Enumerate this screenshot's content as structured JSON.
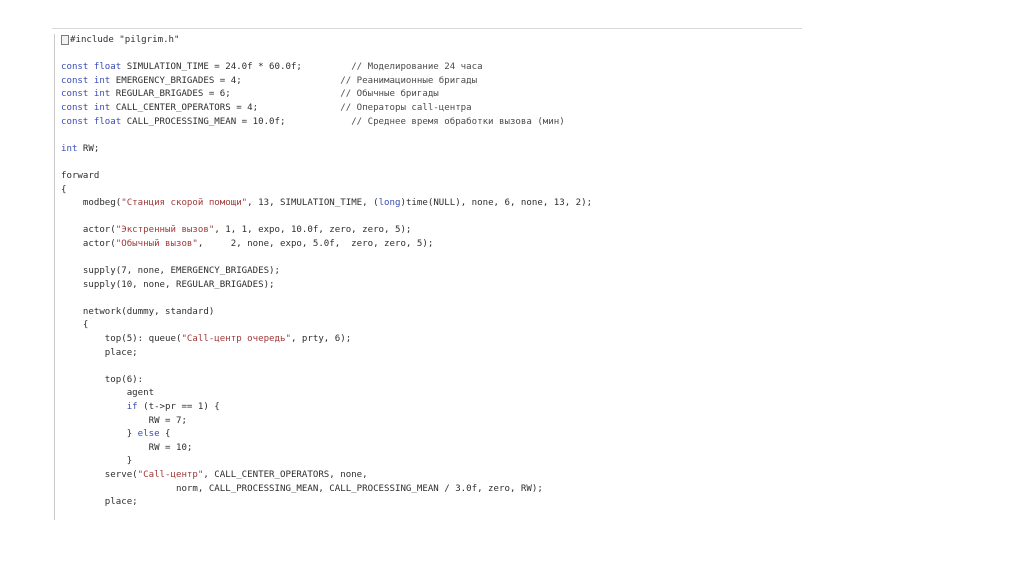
{
  "editor": {
    "lines": [
      [
        {
          "t": "#include \"pilgrim.h\"",
          "c": "txt"
        }
      ],
      [],
      [
        {
          "t": "const float",
          "c": "kw"
        },
        {
          "t": " SIMULATION_TIME = 24.0f * 60.0f;         ",
          "c": "txt"
        },
        {
          "t": "// Моделирование 24 часа",
          "c": "cmt"
        }
      ],
      [
        {
          "t": "const int",
          "c": "kw"
        },
        {
          "t": " EMERGENCY_BRIGADES = 4;                  ",
          "c": "txt"
        },
        {
          "t": "// Реанимационные бригады",
          "c": "cmt"
        }
      ],
      [
        {
          "t": "const int",
          "c": "kw"
        },
        {
          "t": " REGULAR_BRIGADES = 6;                    ",
          "c": "txt"
        },
        {
          "t": "// Обычные бригады",
          "c": "cmt"
        }
      ],
      [
        {
          "t": "const int",
          "c": "kw"
        },
        {
          "t": " CALL_CENTER_OPERATORS = 4;               ",
          "c": "txt"
        },
        {
          "t": "// Операторы call-центра",
          "c": "cmt"
        }
      ],
      [
        {
          "t": "const float",
          "c": "kw"
        },
        {
          "t": " CALL_PROCESSING_MEAN = 10.0f;            ",
          "c": "txt"
        },
        {
          "t": "// Среднее время обработки вызова (мин)",
          "c": "cmt"
        }
      ],
      [],
      [
        {
          "t": "int",
          "c": "kw"
        },
        {
          "t": " RW;",
          "c": "txt"
        }
      ],
      [],
      [
        {
          "t": "forward",
          "c": "txt"
        }
      ],
      [
        {
          "t": "{",
          "c": "txt"
        }
      ],
      [
        {
          "t": "    modbeg(",
          "c": "txt"
        },
        {
          "t": "\"Станция скорой помощи\"",
          "c": "str"
        },
        {
          "t": ", 13, SIMULATION_TIME, (",
          "c": "txt"
        },
        {
          "t": "long",
          "c": "kw"
        },
        {
          "t": ")time(NULL), none, 6, none, 13, 2);",
          "c": "txt"
        }
      ],
      [],
      [
        {
          "t": "    actor(",
          "c": "txt"
        },
        {
          "t": "\"Экстренный вызов\"",
          "c": "str"
        },
        {
          "t": ", 1, 1, expo, 10.0f, zero, zero, 5);",
          "c": "txt"
        }
      ],
      [
        {
          "t": "    actor(",
          "c": "txt"
        },
        {
          "t": "\"Обычный вызов\"",
          "c": "str"
        },
        {
          "t": ",     2, none, expo, 5.0f,  zero, zero, 5);",
          "c": "txt"
        }
      ],
      [],
      [
        {
          "t": "    supply(7, none, EMERGENCY_BRIGADES);",
          "c": "txt"
        }
      ],
      [
        {
          "t": "    supply(10, none, REGULAR_BRIGADES);",
          "c": "txt"
        }
      ],
      [],
      [
        {
          "t": "    network(dummy, standard)",
          "c": "txt"
        }
      ],
      [
        {
          "t": "    {",
          "c": "txt"
        }
      ],
      [
        {
          "t": "        top(5): queue(",
          "c": "txt"
        },
        {
          "t": "\"Call-центр очередь\"",
          "c": "str"
        },
        {
          "t": ", prty, 6);",
          "c": "txt"
        }
      ],
      [
        {
          "t": "        place;",
          "c": "txt"
        }
      ],
      [],
      [
        {
          "t": "        top(6):",
          "c": "txt"
        }
      ],
      [
        {
          "t": "            agent",
          "c": "txt"
        }
      ],
      [
        {
          "t": "            ",
          "c": "txt"
        },
        {
          "t": "if",
          "c": "kw"
        },
        {
          "t": " (t->pr == 1) {",
          "c": "txt"
        }
      ],
      [
        {
          "t": "                RW = 7;",
          "c": "txt"
        }
      ],
      [
        {
          "t": "            } ",
          "c": "txt"
        },
        {
          "t": "else",
          "c": "kw"
        },
        {
          "t": " {",
          "c": "txt"
        }
      ],
      [
        {
          "t": "                RW = 10;",
          "c": "txt"
        }
      ],
      [
        {
          "t": "            }",
          "c": "txt"
        }
      ],
      [
        {
          "t": "        serve(",
          "c": "txt"
        },
        {
          "t": "\"Call-центр\"",
          "c": "str"
        },
        {
          "t": ", CALL_CENTER_OPERATORS, none,",
          "c": "txt"
        }
      ],
      [
        {
          "t": "                     norm, CALL_PROCESSING_MEAN, CALL_PROCESSING_MEAN / 3.0f, zero, RW);",
          "c": "txt"
        }
      ],
      [
        {
          "t": "        place;",
          "c": "txt"
        }
      ]
    ]
  }
}
